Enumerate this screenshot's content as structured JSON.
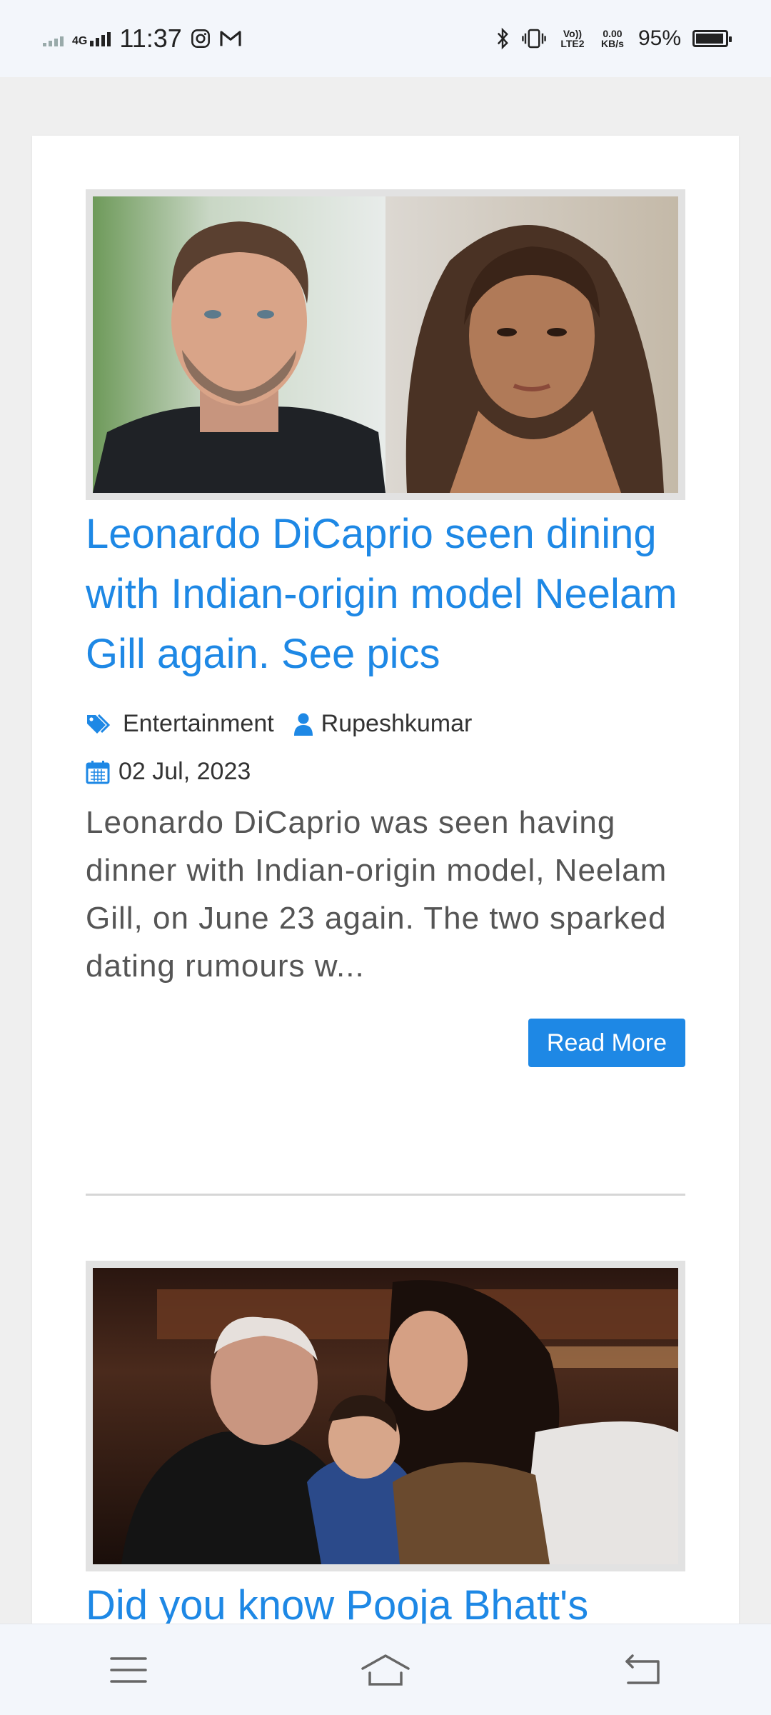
{
  "status_bar": {
    "network": "4G",
    "time": "11:37",
    "volte": "Vo)) LTE2",
    "speed_value": "0.00",
    "speed_unit": "KB/s",
    "battery": "95%",
    "battery_level": 0.95,
    "icons": [
      "signal-weak-icon",
      "signal-icon",
      "instagram-icon",
      "gmail-icon",
      "bluetooth-icon",
      "vibrate-icon",
      "battery-icon"
    ]
  },
  "posts": [
    {
      "title": "Leonardo DiCaprio seen dining with Indian-origin model Neelam Gill again. See pics",
      "category": "Entertainment",
      "author": "Rupeshkumar",
      "date": "02 Jul, 2023",
      "excerpt": "Leonardo DiCaprio was seen having dinner with Indian-origin model, Neelam Gill, on June 23 again. The two sparked dating rumours w...",
      "read_more": "Read More"
    },
    {
      "title": "Did you know Pooja Bhatt's"
    }
  ],
  "colors": {
    "link": "#1e88e5",
    "button": "#1e88e5",
    "page_bg": "#efefef"
  },
  "nav": {
    "icons": [
      "menu-icon",
      "home-icon",
      "back-icon"
    ]
  }
}
